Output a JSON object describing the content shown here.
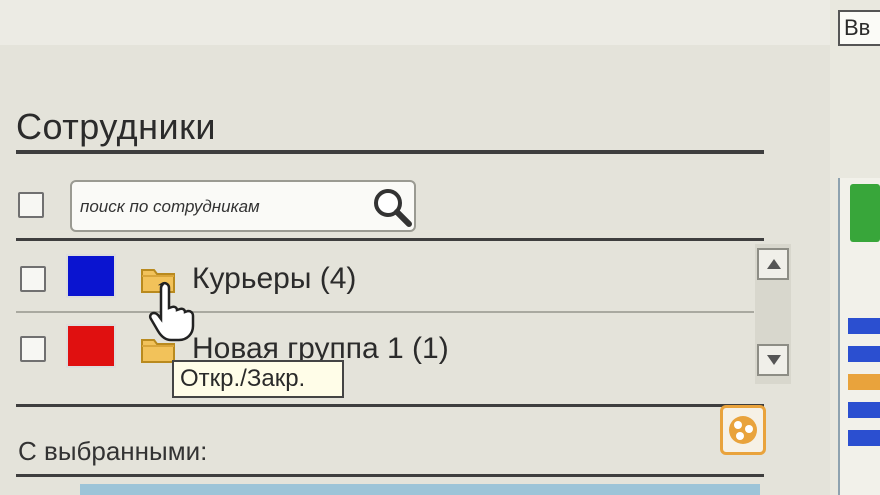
{
  "header": {
    "title": "Сотрудники",
    "top_right_button": "Вв"
  },
  "search": {
    "placeholder": "поиск по сотрудникам"
  },
  "groups": [
    {
      "label": "Курьеры (4)",
      "color": "#0a14d0"
    },
    {
      "label": "Новая группа 1 (1)",
      "color": "#e01010"
    }
  ],
  "tooltip": "Откр./Закр.",
  "footer": {
    "with_selected_label": "С выбранными:"
  },
  "colors": {
    "accent_orange": "#e9a33c",
    "accent_green": "#38a63a",
    "accent_blue": "#2b4fd0"
  },
  "icons": [
    "search-icon",
    "folder-icon",
    "hand-cursor-icon",
    "scroll-up-icon",
    "scroll-down-icon",
    "share-action-icon"
  ]
}
